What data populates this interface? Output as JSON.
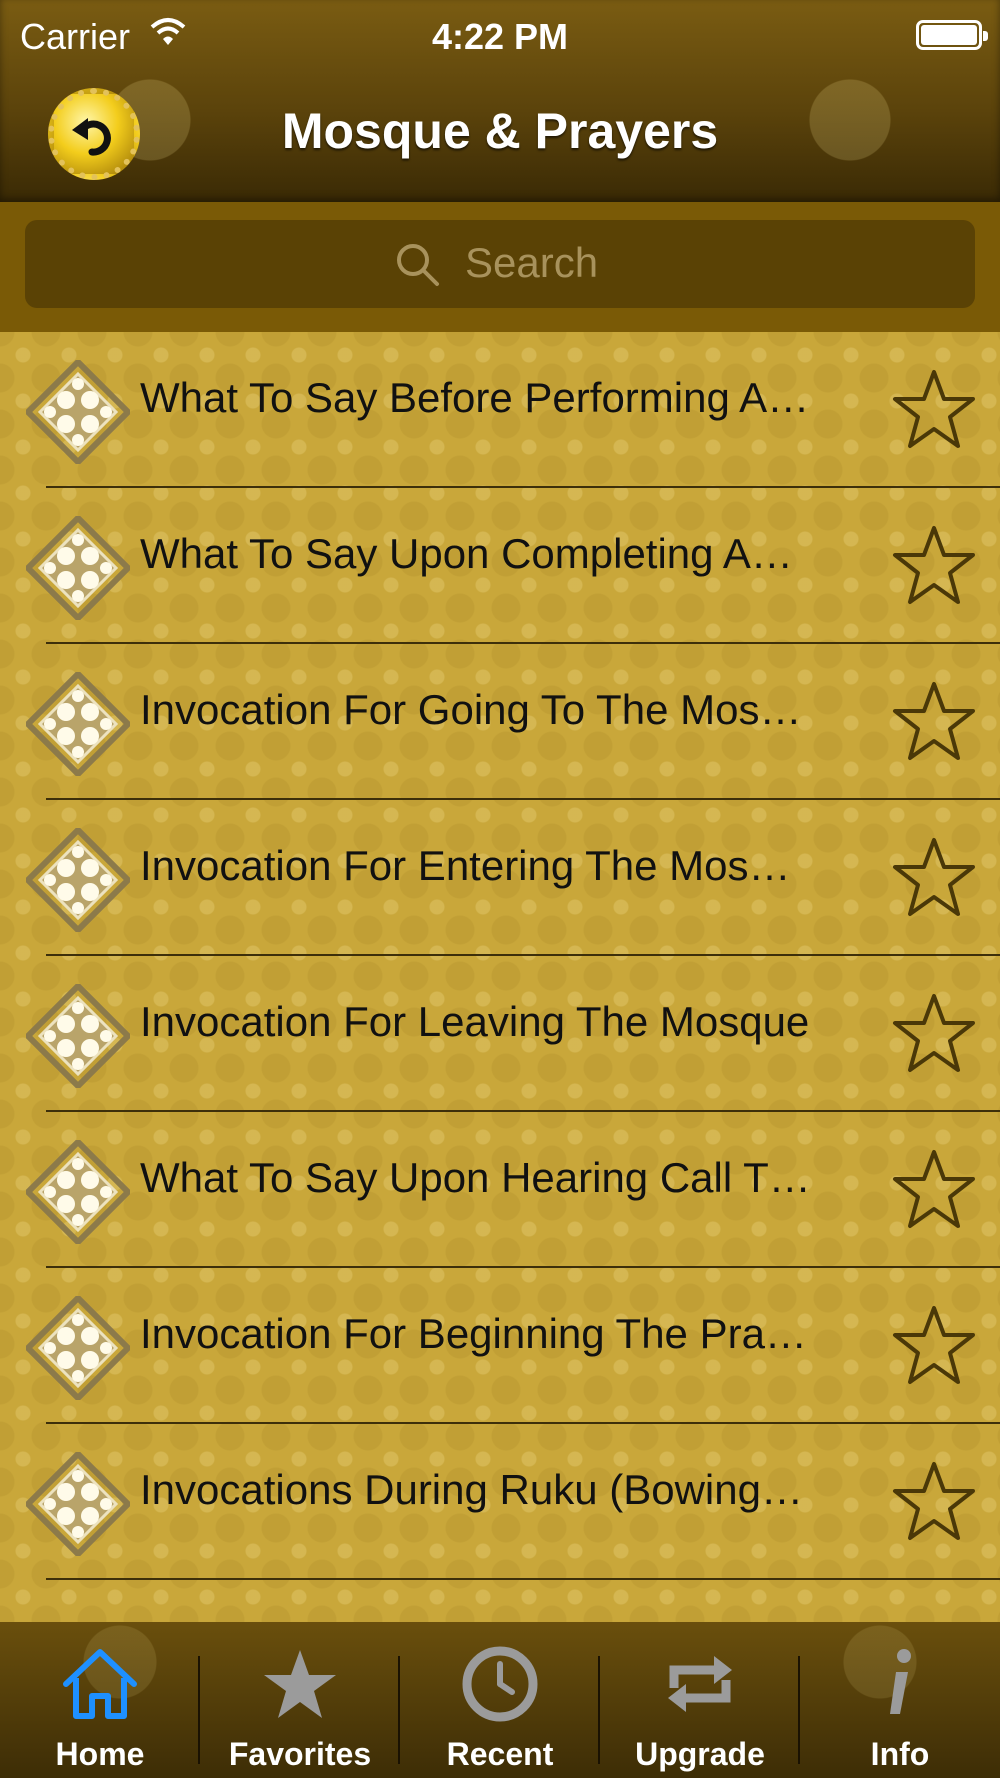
{
  "status_bar": {
    "carrier": "Carrier",
    "time": "4:22 PM"
  },
  "nav": {
    "title": "Mosque & Prayers",
    "back_icon": "back-arrow-icon"
  },
  "search": {
    "placeholder": "Search"
  },
  "list": {
    "items": [
      {
        "label": "What To Say Before Performing A…",
        "favorite": false
      },
      {
        "label": "What To Say Upon Completing A…",
        "favorite": false
      },
      {
        "label": "Invocation For Going To The Mos…",
        "favorite": false
      },
      {
        "label": "Invocation For Entering The Mos…",
        "favorite": false
      },
      {
        "label": "Invocation For Leaving The Mosque",
        "favorite": false
      },
      {
        "label": "What To Say Upon Hearing Call T…",
        "favorite": false
      },
      {
        "label": "Invocation For Beginning The Pra…",
        "favorite": false
      },
      {
        "label": "Invocations During Ruku (Bowing…",
        "favorite": false
      }
    ]
  },
  "tabbar": {
    "tabs": [
      {
        "label": "Home",
        "icon": "home-icon",
        "active": true
      },
      {
        "label": "Favorites",
        "icon": "star-icon",
        "active": false
      },
      {
        "label": "Recent",
        "icon": "clock-icon",
        "active": false
      },
      {
        "label": "Upgrade",
        "icon": "repeat-icon",
        "active": false
      },
      {
        "label": "Info",
        "icon": "info-icon",
        "active": false
      }
    ]
  },
  "colors": {
    "active_tab": "#1e90ff",
    "inactive_tab_icon": "#9b9b9b",
    "list_background": "#c9a73a"
  }
}
